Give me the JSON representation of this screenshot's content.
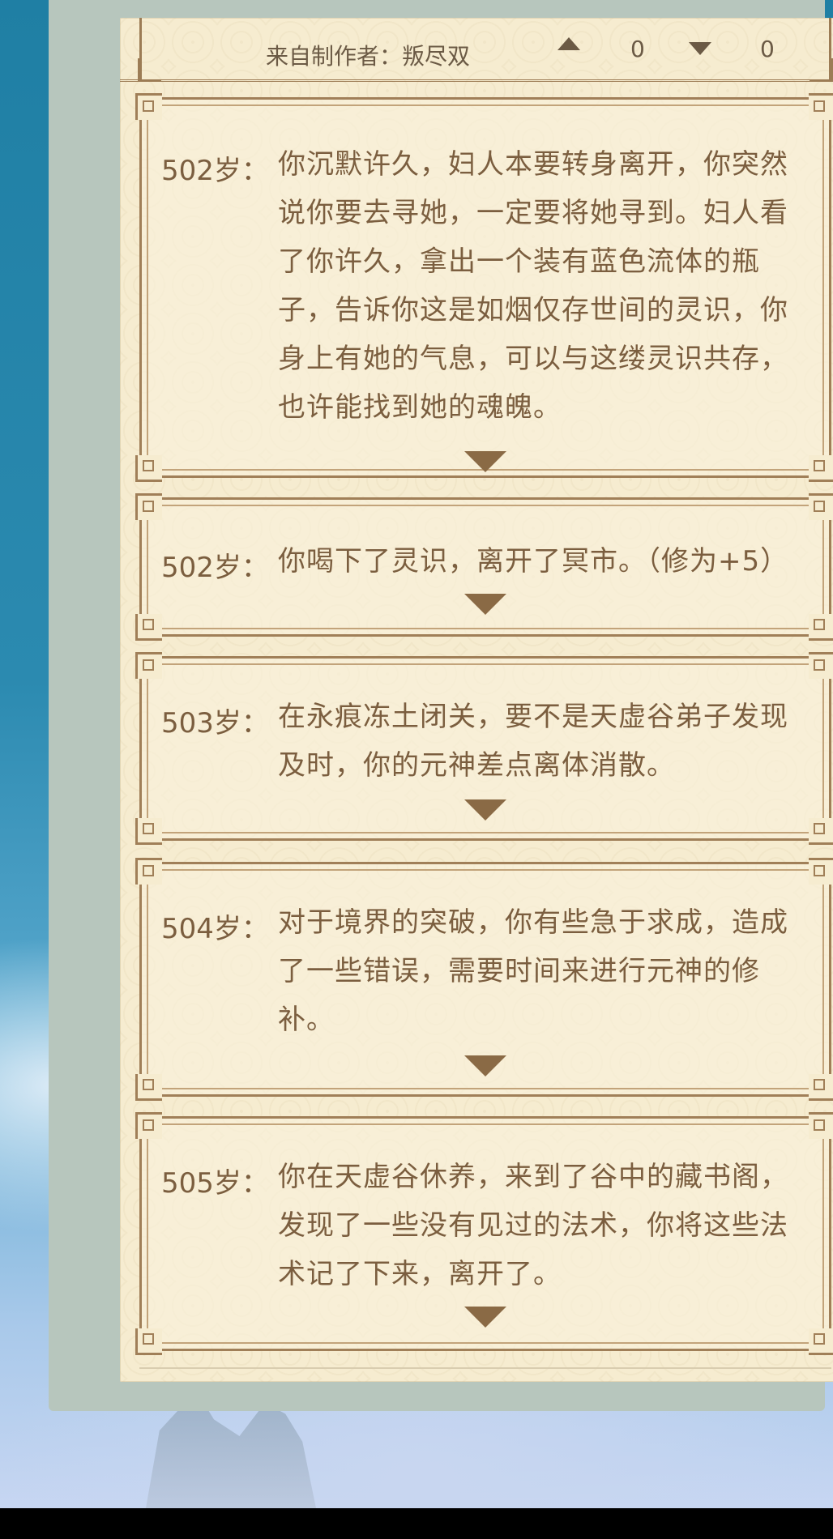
{
  "header_partial": {
    "author": "来自制作者：叛尽双",
    "upvotes": "0",
    "downvotes": "0"
  },
  "events": [
    {
      "age": "502岁：",
      "text": "你沉默许久，妇人本要转身离开，你突然说你要去寻她，一定要将她寻到。妇人看了你许久，拿出一个装有蓝色流体的瓶子，告诉你这是如烟仅存世间的灵识，你身上有她的气息，可以与这缕灵识共存，也许能找到她的魂魄。"
    },
    {
      "age": "502岁：",
      "text": "你喝下了灵识，离开了冥市。（修为+5）"
    },
    {
      "age": "503岁：",
      "text": "在永痕冻土闭关，要不是天虚谷弟子发现及时，你的元神差点离体消散。"
    },
    {
      "age": "504岁：",
      "text": "对于境界的突破，你有些急于求成，造成了一些错误，需要时间来进行元神的修补。"
    },
    {
      "age": "505岁：",
      "text": "你在天虚谷休养，来到了谷中的藏书阁，发现了一些没有见过的法术，你将这些法术记了下来，离开了。"
    }
  ],
  "icons": {
    "expand": "chevron-down-icon",
    "upvote": "thumb-up-icon",
    "downvote": "thumb-down-icon"
  },
  "colors": {
    "text": "#7b5e3f",
    "paper": "#f6ecd0",
    "frame": "#a07f58"
  }
}
